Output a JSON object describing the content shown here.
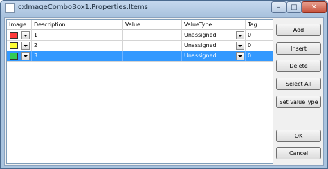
{
  "window": {
    "title": "cxImageComboBox1.Properties.Items",
    "min_glyph": "–",
    "max_glyph": "□",
    "close_glyph": "✕"
  },
  "grid": {
    "columns": [
      "Image",
      "Description",
      "Value",
      "ValueType",
      "Tag"
    ],
    "rows": [
      {
        "color": "#ff3b3b",
        "description": "1",
        "value": "",
        "valuetype": "Unassigned",
        "tag": "0",
        "selected": false
      },
      {
        "color": "#ffff33",
        "description": "2",
        "value": "",
        "valuetype": "Unassigned",
        "tag": "0",
        "selected": false
      },
      {
        "color": "#33cc55",
        "description": "3",
        "value": "",
        "valuetype": "Unassigned",
        "tag": "0",
        "selected": true
      }
    ]
  },
  "buttons": {
    "add": "Add",
    "insert": "Insert",
    "delete": "Delete",
    "select_all": "Select All",
    "set_value_type": "Set ValueType",
    "ok": "OK",
    "cancel": "Cancel"
  }
}
